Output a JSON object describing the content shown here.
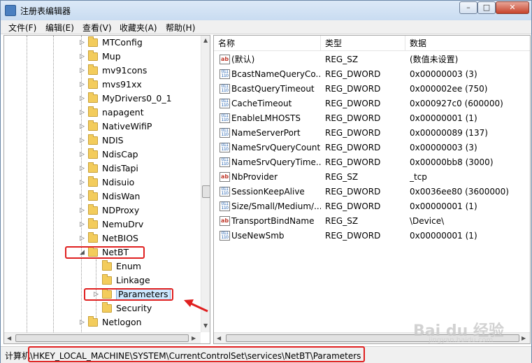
{
  "window": {
    "title": "注册表编辑器",
    "buttons": {
      "minimize": "–",
      "maximize": "□",
      "close": "✕"
    }
  },
  "menu": [
    "文件(F)",
    "编辑(E)",
    "查看(V)",
    "收藏夹(A)",
    "帮助(H)"
  ],
  "tree": {
    "items": [
      {
        "label": "MTConfig",
        "expander": "▷"
      },
      {
        "label": "Mup",
        "expander": "▷"
      },
      {
        "label": "mv91cons",
        "expander": "▷"
      },
      {
        "label": "mvs91xx",
        "expander": "▷"
      },
      {
        "label": "MyDrivers0_0_1",
        "expander": "▷"
      },
      {
        "label": "napagent",
        "expander": "▷"
      },
      {
        "label": "NativeWifiP",
        "expander": "▷"
      },
      {
        "label": "NDIS",
        "expander": "▷"
      },
      {
        "label": "NdisCap",
        "expander": "▷"
      },
      {
        "label": "NdisTapi",
        "expander": "▷"
      },
      {
        "label": "Ndisuio",
        "expander": "▷"
      },
      {
        "label": "NdisWan",
        "expander": "▷"
      },
      {
        "label": "NDProxy",
        "expander": "▷"
      },
      {
        "label": "NemuDrv",
        "expander": "▷"
      },
      {
        "label": "NetBIOS",
        "expander": "▷"
      },
      {
        "label": "NetBT",
        "expander": "◢"
      },
      {
        "label": "Enum",
        "expander": ""
      },
      {
        "label": "Linkage",
        "expander": ""
      },
      {
        "label": "Parameters",
        "expander": "▷"
      },
      {
        "label": "Security",
        "expander": ""
      },
      {
        "label": "Netlogon",
        "expander": "▷"
      }
    ]
  },
  "list": {
    "columns": [
      "名称",
      "类型",
      "数据"
    ],
    "rows": [
      {
        "icon": "ab",
        "name": "(默认)",
        "type": "REG_SZ",
        "data": "(数值未设置)"
      },
      {
        "icon": "bin",
        "name": "BcastNameQueryCo...",
        "type": "REG_DWORD",
        "data": "0x00000003 (3)"
      },
      {
        "icon": "bin",
        "name": "BcastQueryTimeout",
        "type": "REG_DWORD",
        "data": "0x000002ee (750)"
      },
      {
        "icon": "bin",
        "name": "CacheTimeout",
        "type": "REG_DWORD",
        "data": "0x000927c0 (600000)"
      },
      {
        "icon": "bin",
        "name": "EnableLMHOSTS",
        "type": "REG_DWORD",
        "data": "0x00000001 (1)"
      },
      {
        "icon": "bin",
        "name": "NameServerPort",
        "type": "REG_DWORD",
        "data": "0x00000089 (137)"
      },
      {
        "icon": "bin",
        "name": "NameSrvQueryCount",
        "type": "REG_DWORD",
        "data": "0x00000003 (3)"
      },
      {
        "icon": "bin",
        "name": "NameSrvQueryTime...",
        "type": "REG_DWORD",
        "data": "0x00000bb8 (3000)"
      },
      {
        "icon": "ab",
        "name": "NbProvider",
        "type": "REG_SZ",
        "data": "_tcp"
      },
      {
        "icon": "bin",
        "name": "SessionKeepAlive",
        "type": "REG_DWORD",
        "data": "0x0036ee80 (3600000)"
      },
      {
        "icon": "bin",
        "name": "Size/Small/Medium/...",
        "type": "REG_DWORD",
        "data": "0x00000001 (1)"
      },
      {
        "icon": "ab",
        "name": "TransportBindName",
        "type": "REG_SZ",
        "data": "\\Device\\"
      },
      {
        "icon": "bin",
        "name": "UseNewSmb",
        "type": "REG_DWORD",
        "data": "0x00000001 (1)"
      }
    ]
  },
  "status": {
    "path": "计算机\\HKEY_LOCAL_MACHINE\\SYSTEM\\CurrentControlSet\\services\\NetBT\\Parameters"
  },
  "watermark": {
    "logo": "Bai du 经验",
    "sub": "jingyan.baidu.com"
  },
  "annotation_color": "#e02020"
}
